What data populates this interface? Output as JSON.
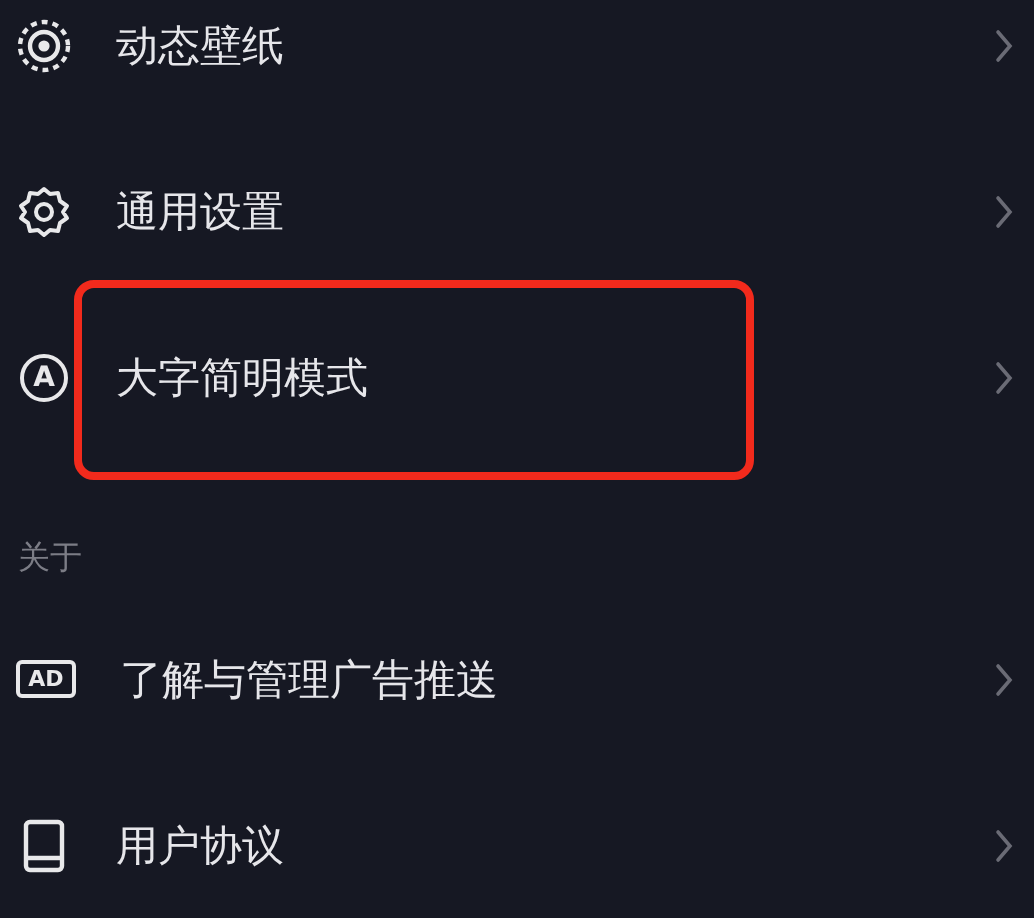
{
  "sections": [
    {
      "items": [
        {
          "kind": "wallpaper",
          "label": "动态壁纸",
          "highlighted": false
        },
        {
          "kind": "gear",
          "label": "通用设置",
          "highlighted": false
        },
        {
          "kind": "letter",
          "icon_text": "A",
          "label": "大字简明模式",
          "highlighted": true
        }
      ]
    },
    {
      "header": "关于",
      "items": [
        {
          "kind": "tag",
          "icon_text": "AD",
          "label": "了解与管理广告推送",
          "highlighted": false
        },
        {
          "kind": "book",
          "label": "用户协议",
          "highlighted": false
        }
      ]
    }
  ]
}
